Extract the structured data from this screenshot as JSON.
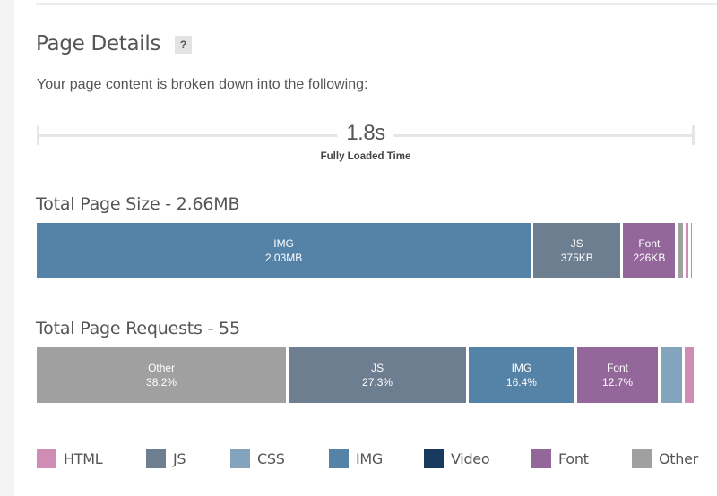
{
  "header": {
    "title": "Page Details",
    "help_label": "?",
    "subtitle": "Your page content is broken down into the following:"
  },
  "timeline": {
    "value": "1.8s",
    "label": "Fully Loaded Time"
  },
  "colors": {
    "HTML": "#cf8db5",
    "JS": "#6e7e91",
    "CSS": "#84a3bd",
    "IMG": "#5582a7",
    "Video": "#173a5e",
    "Font": "#93679a",
    "Other": "#a0a0a0"
  },
  "page_size": {
    "title": "Total Page Size - 2.66MB",
    "segments": [
      {
        "type": "IMG",
        "label": "IMG",
        "value": "2.03MB",
        "fraction": 0.753
      },
      {
        "type": "JS",
        "label": "JS",
        "value": "375KB",
        "fraction": 0.136
      },
      {
        "type": "Font",
        "label": "Font",
        "value": "226KB",
        "fraction": 0.083
      },
      {
        "type": "Other",
        "label": "",
        "value": "",
        "fraction": 0.012
      },
      {
        "type": "HTML",
        "label": "",
        "value": "",
        "fraction": 0.008
      },
      {
        "type": "CSS",
        "label": "",
        "value": "",
        "fraction": 0.003
      }
    ]
  },
  "page_requests": {
    "title": "Total Page Requests - 55",
    "segments": [
      {
        "type": "Other",
        "label": "Other",
        "value": "38.2%",
        "fraction": 0.382
      },
      {
        "type": "JS",
        "label": "JS",
        "value": "27.3%",
        "fraction": 0.273
      },
      {
        "type": "IMG",
        "label": "IMG",
        "value": "16.4%",
        "fraction": 0.164
      },
      {
        "type": "Font",
        "label": "Font",
        "value": "12.7%",
        "fraction": 0.127
      },
      {
        "type": "CSS",
        "label": "",
        "value": "",
        "fraction": 0.036
      },
      {
        "type": "HTML",
        "label": "",
        "value": "",
        "fraction": 0.018
      }
    ]
  },
  "legend": [
    {
      "type": "HTML",
      "label": "HTML"
    },
    {
      "type": "JS",
      "label": "JS"
    },
    {
      "type": "CSS",
      "label": "CSS"
    },
    {
      "type": "IMG",
      "label": "IMG"
    },
    {
      "type": "Video",
      "label": "Video"
    },
    {
      "type": "Font",
      "label": "Font"
    },
    {
      "type": "Other",
      "label": "Other"
    }
  ]
}
